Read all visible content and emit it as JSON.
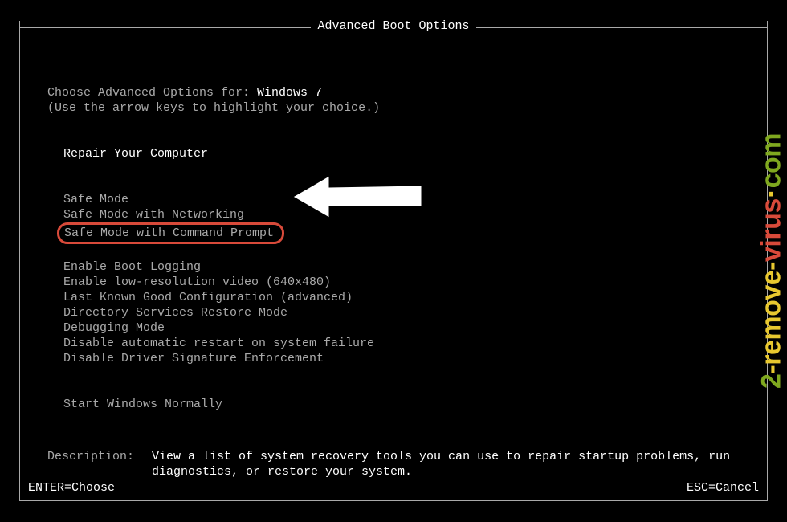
{
  "title": "Advanced Boot Options",
  "instruction_prefix": "Choose Advanced Options for: ",
  "os_name": "Windows 7",
  "arrow_hint": "(Use the arrow keys to highlight your choice.)",
  "groups": {
    "repair": "Repair Your Computer",
    "safe": {
      "mode": "Safe Mode",
      "networking": "Safe Mode with Networking",
      "cmd": "Safe Mode with Command Prompt"
    },
    "advanced": {
      "boot_logging": "Enable Boot Logging",
      "low_res": "Enable low-resolution video (640x480)",
      "last_known": "Last Known Good Configuration (advanced)",
      "dsrm": "Directory Services Restore Mode",
      "debugging": "Debugging Mode",
      "no_restart": "Disable automatic restart on system failure",
      "no_sig": "Disable Driver Signature Enforcement"
    },
    "normal": "Start Windows Normally"
  },
  "description": {
    "label": "Description:",
    "text": "View a list of system recovery tools you can use to repair startup problems, run diagnostics, or restore your system."
  },
  "footer": {
    "enter": "ENTER=Choose",
    "esc": "ESC=Cancel"
  },
  "watermark": {
    "part1": "2",
    "part2": "-remove-",
    "part3": "virus",
    "part4": ".com"
  }
}
